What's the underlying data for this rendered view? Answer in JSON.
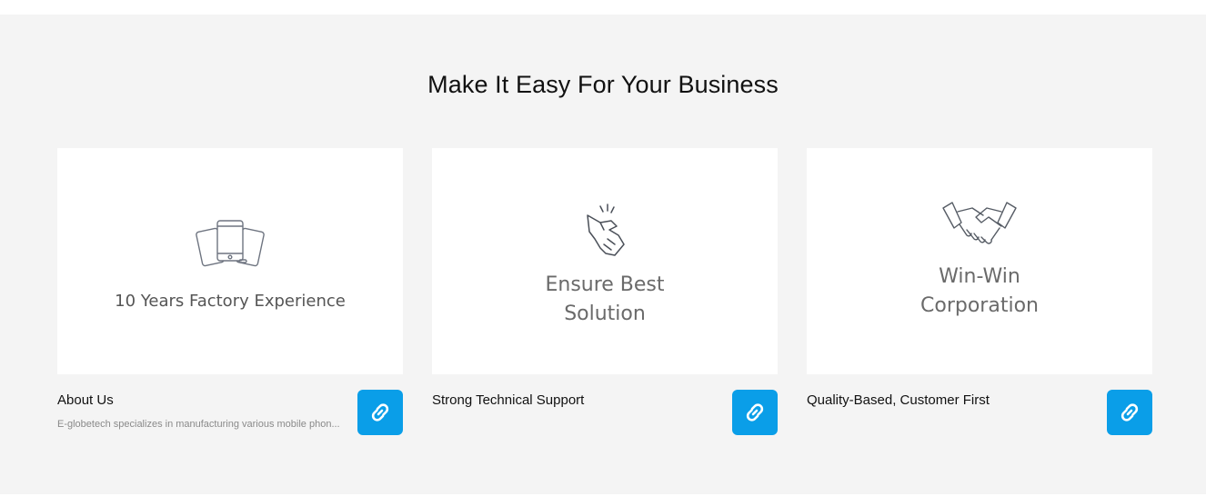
{
  "section": {
    "title": "Make It Easy For Your Business",
    "background": "#f4f4f4"
  },
  "cards": [
    {
      "image_text": "10 Years Factory Experience",
      "image_icon": "mobile-devices-icon",
      "title": "About Us",
      "description": "E-globetech specializes in manufacturing various mobile phon...",
      "button_icon": "link-icon"
    },
    {
      "image_text_line1": "Ensure Best",
      "image_text_line2": "Solution",
      "image_icon": "finger-snap-icon",
      "title": "Strong Technical Support",
      "description": "",
      "button_icon": "link-icon"
    },
    {
      "image_text_line1": "Win-Win",
      "image_text_line2": "Corporation",
      "image_icon": "handshake-icon",
      "title": "Quality-Based, Customer First",
      "description": "",
      "button_icon": "link-icon"
    }
  ],
  "colors": {
    "accent": "#0a9ee8",
    "card_background": "#ffffff",
    "title_text": "#111111",
    "muted_text": "#8a8a8a"
  }
}
